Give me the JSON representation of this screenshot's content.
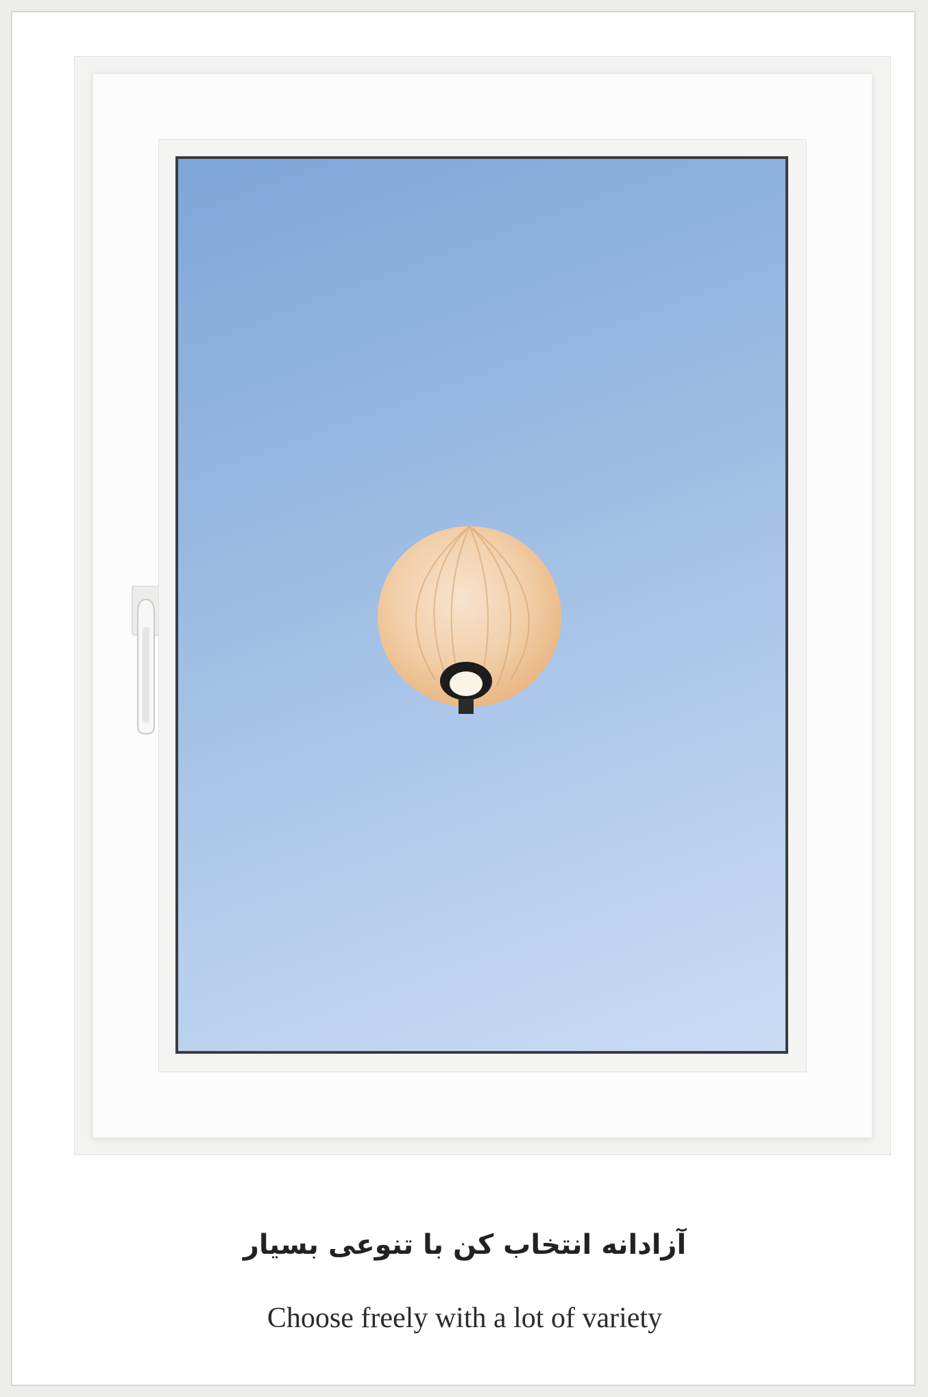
{
  "caption": {
    "title_fa": "آزادانه انتخاب کن با تنوعی بسیار",
    "subtitle_en": "Choose freely with a lot of variety"
  },
  "colors": {
    "sky_top": "#7da7d8",
    "sky_bottom": "#cadcf4",
    "frame": "#fcfcfc",
    "balloon": "#f3d2b0"
  },
  "icons": {
    "handle": "window-handle-icon",
    "balloon": "hot-air-balloon-icon"
  }
}
